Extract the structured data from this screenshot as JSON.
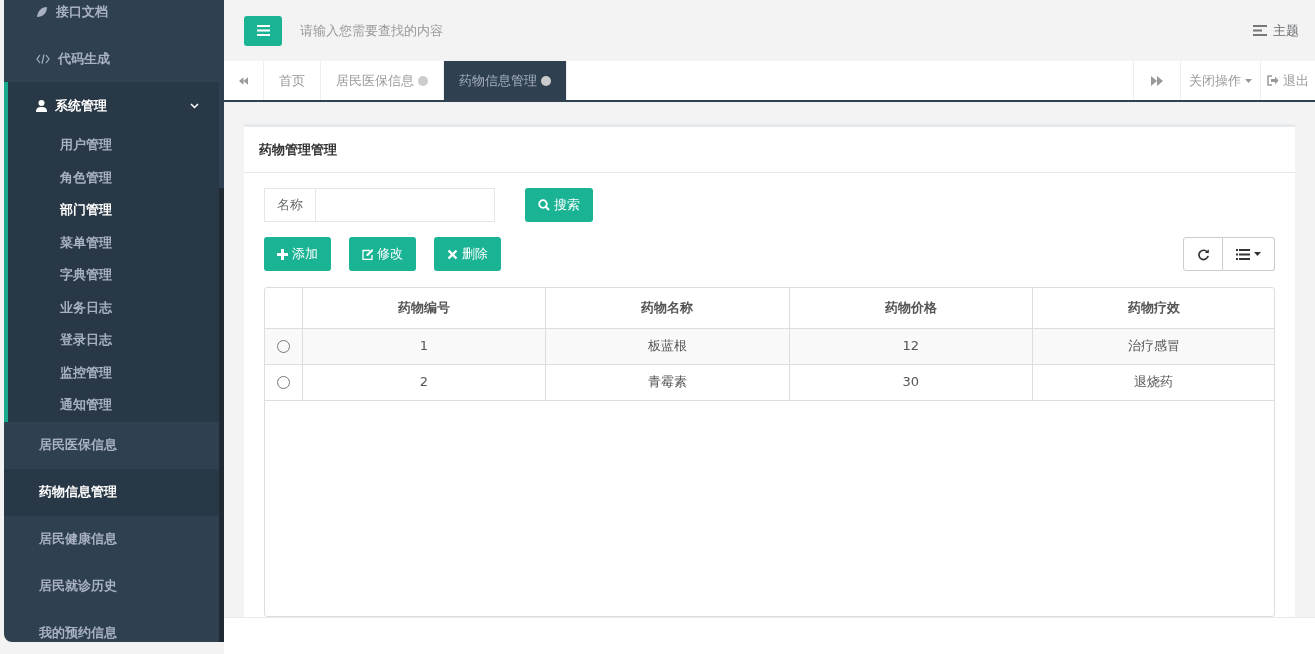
{
  "sidebar": {
    "items": [
      {
        "label": "接口文档",
        "kind": "doc",
        "selected": false
      },
      {
        "label": "代码生成",
        "kind": "code",
        "selected": false
      },
      {
        "label": "系统管理",
        "kind": "group",
        "expanded": true,
        "children": [
          {
            "label": "用户管理",
            "selected": false
          },
          {
            "label": "角色管理",
            "selected": false
          },
          {
            "label": "部门管理",
            "selected": true
          },
          {
            "label": "菜单管理",
            "selected": false
          },
          {
            "label": "字典管理",
            "selected": false
          },
          {
            "label": "业务日志",
            "selected": false
          },
          {
            "label": "登录日志",
            "selected": false
          },
          {
            "label": "监控管理",
            "selected": false
          },
          {
            "label": "通知管理",
            "selected": false
          }
        ]
      },
      {
        "label": "居民医保信息",
        "kind": "page",
        "selected": false
      },
      {
        "label": "药物信息管理",
        "kind": "page",
        "selected": true
      },
      {
        "label": "居民健康信息",
        "kind": "page",
        "selected": false
      },
      {
        "label": "居民就诊历史",
        "kind": "page",
        "selected": false
      },
      {
        "label": "我的预约信息",
        "kind": "page",
        "selected": false
      }
    ]
  },
  "header": {
    "search": {
      "placeholder": "请输入您需要查找的内容"
    },
    "theme": "主题"
  },
  "tabs": [
    {
      "label": "首页",
      "closable": false,
      "selected": false
    },
    {
      "label": "居民医保信息",
      "closable": true,
      "selected": false
    },
    {
      "label": "药物信息管理",
      "closable": true,
      "selected": true
    }
  ],
  "tab_actions": {
    "close_menu": "关闭操作",
    "logout": "退出"
  },
  "panel": {
    "title": "药物管理管理",
    "filter": {
      "label": "名称"
    },
    "search_button": "搜索",
    "toolbar": [
      {
        "kind": "add",
        "label": "添加"
      },
      {
        "kind": "edit",
        "label": "修改"
      },
      {
        "kind": "delete",
        "label": "删除"
      }
    ],
    "table": {
      "columns": [
        "药物编号",
        "药物名称",
        "药物价格",
        "药物疗效"
      ],
      "rows": [
        {
          "selected": false,
          "cells": [
            "1",
            "板蓝根",
            "12",
            "治疗感冒"
          ]
        },
        {
          "selected": false,
          "cells": [
            "2",
            "青霉素",
            "30",
            "退烧药"
          ]
        }
      ]
    }
  }
}
